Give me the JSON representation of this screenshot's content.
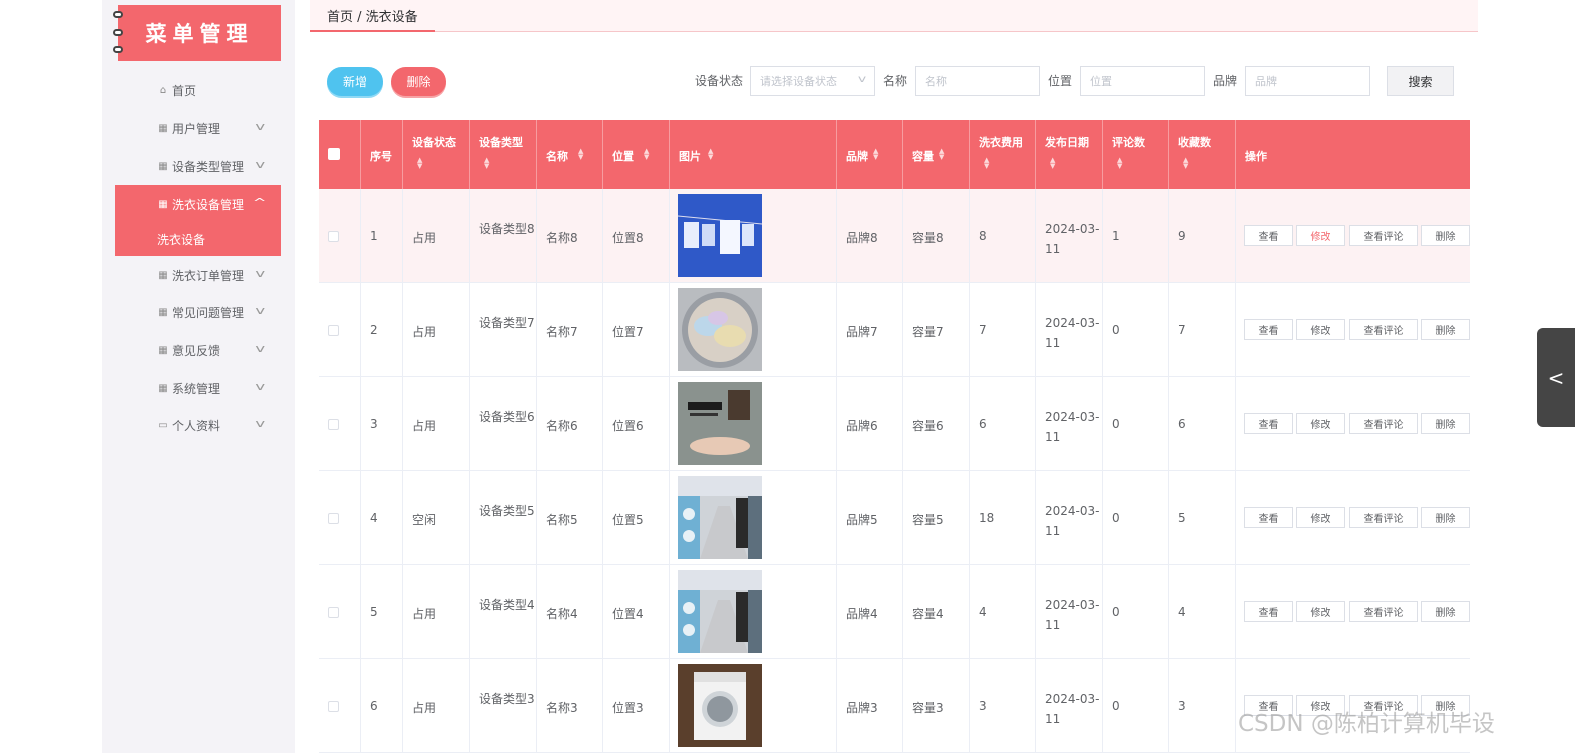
{
  "sidebar": {
    "logo_text": "菜单管理",
    "items": [
      {
        "label": "首页",
        "icon": "home-icon"
      },
      {
        "label": "用户管理",
        "icon": "grid-icon"
      },
      {
        "label": "设备类型管理",
        "icon": "grid-icon"
      },
      {
        "label": "洗衣设备管理",
        "icon": "grid-icon"
      },
      {
        "label": "洗衣订单管理",
        "icon": "grid-icon"
      },
      {
        "label": "常见问题管理",
        "icon": "grid-icon"
      },
      {
        "label": "意见反馈",
        "icon": "grid-icon"
      },
      {
        "label": "系统管理",
        "icon": "grid-icon"
      },
      {
        "label": "个人资料",
        "icon": "card-icon"
      }
    ],
    "active_sub": "洗衣设备"
  },
  "breadcrumb": "首页 / 洗衣设备",
  "toolbar": {
    "add_label": "新增",
    "delete_label": "删除",
    "status_label": "设备状态",
    "status_placeholder": "请选择设备状态",
    "name_label": "名称",
    "name_placeholder": "名称",
    "location_label": "位置",
    "location_placeholder": "位置",
    "brand_label": "品牌",
    "brand_placeholder": "品牌",
    "search_label": "搜索"
  },
  "table": {
    "headers": [
      "序号",
      "设备状态",
      "设备类型",
      "名称",
      "位置",
      "图片",
      "品牌",
      "容量",
      "洗衣费用",
      "发布日期",
      "评论数",
      "收藏数",
      "操作"
    ],
    "actions": [
      "查看",
      "修改",
      "查看评论",
      "删除"
    ],
    "rows": [
      {
        "no": "1",
        "status": "占用",
        "type": "设备类型8",
        "name": "名称8",
        "location": "位置8",
        "image": "clothesline-photo",
        "brand": "品牌8",
        "capacity": "容量8",
        "fee": "8",
        "date": "2024-03-11",
        "comments": "1",
        "favorites": "9"
      },
      {
        "no": "2",
        "status": "占用",
        "type": "设备类型7",
        "name": "名称7",
        "location": "位置7",
        "image": "washer-drum-laundry-photo",
        "brand": "品牌7",
        "capacity": "容量7",
        "fee": "7",
        "date": "2024-03-11",
        "comments": "0",
        "favorites": "7"
      },
      {
        "no": "3",
        "status": "占用",
        "type": "设备类型6",
        "name": "名称6",
        "location": "位置6",
        "image": "poster-photo",
        "brand": "品牌6",
        "capacity": "容量6",
        "fee": "6",
        "date": "2024-03-11",
        "comments": "0",
        "favorites": "6"
      },
      {
        "no": "4",
        "status": "空闲",
        "type": "设备类型5",
        "name": "名称5",
        "location": "位置5",
        "image": "laundromat-photo",
        "brand": "品牌5",
        "capacity": "容量5",
        "fee": "18",
        "date": "2024-03-11",
        "comments": "0",
        "favorites": "5"
      },
      {
        "no": "5",
        "status": "占用",
        "type": "设备类型4",
        "name": "名称4",
        "location": "位置4",
        "image": "laundromat-photo",
        "brand": "品牌4",
        "capacity": "容量4",
        "fee": "4",
        "date": "2024-03-11",
        "comments": "0",
        "favorites": "4"
      },
      {
        "no": "6",
        "status": "占用",
        "type": "设备类型3",
        "name": "名称3",
        "location": "位置3",
        "image": "front-loader-photo",
        "brand": "品牌3",
        "capacity": "容量3",
        "fee": "3",
        "date": "2024-03-11",
        "comments": "0",
        "favorites": "3"
      }
    ]
  },
  "watermark": "CSDN @陈柏计算机毕设",
  "colors": {
    "accent": "#f3676d",
    "add_button": "#4fc3ef"
  }
}
